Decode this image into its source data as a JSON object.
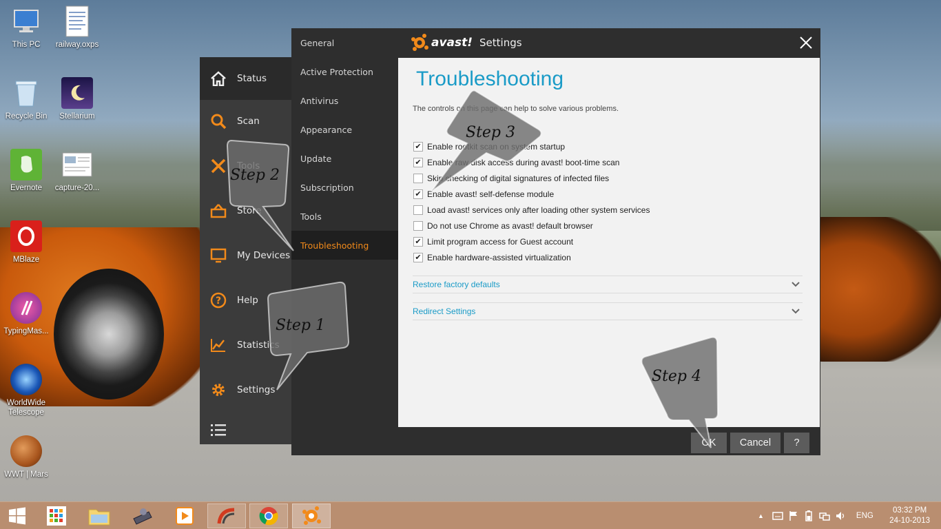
{
  "desktop": {
    "icons": [
      {
        "label": "This PC"
      },
      {
        "label": "railway.oxps"
      },
      {
        "label": "Recycle Bin"
      },
      {
        "label": "Stellarium"
      },
      {
        "label": "Evernote"
      },
      {
        "label": "capture-20..."
      },
      {
        "label": "MBlaze"
      },
      {
        "label": "TypingMas..."
      },
      {
        "label": "WorldWide Telescope"
      },
      {
        "label": "WWT | Mars"
      }
    ]
  },
  "avast_main": {
    "nav": [
      {
        "label": "Status",
        "icon": "home-icon"
      },
      {
        "label": "Scan",
        "icon": "search-icon"
      },
      {
        "label": "Tools",
        "icon": "wrench-icon"
      },
      {
        "label": "Store",
        "icon": "basket-icon"
      },
      {
        "label": "My Devices",
        "icon": "monitor-icon"
      },
      {
        "label": "Help",
        "icon": "help-icon"
      },
      {
        "label": "Statistics",
        "icon": "chart-icon"
      },
      {
        "label": "Settings",
        "icon": "gear-icon"
      }
    ]
  },
  "settings": {
    "logo_text": "avast!",
    "title": "Settings",
    "menu": [
      {
        "label": "General"
      },
      {
        "label": "Active Protection"
      },
      {
        "label": "Antivirus"
      },
      {
        "label": "Appearance"
      },
      {
        "label": "Update"
      },
      {
        "label": "Subscription"
      },
      {
        "label": "Tools"
      },
      {
        "label": "Troubleshooting"
      }
    ],
    "page_title": "Troubleshooting",
    "description": "The controls on this page can help to solve various problems.",
    "options": [
      {
        "label": "Enable rootkit scan on system startup",
        "checked": true
      },
      {
        "label": "Enable raw disk access during avast! boot-time scan",
        "checked": true
      },
      {
        "label": "Skip checking of digital signatures of infected files",
        "checked": false
      },
      {
        "label": "Enable avast! self-defense module",
        "checked": true
      },
      {
        "label": "Load avast! services only after loading other system services",
        "checked": false
      },
      {
        "label": "Do not use Chrome as avast! default browser",
        "checked": false
      },
      {
        "label": "Limit program access for Guest account",
        "checked": true
      },
      {
        "label": "Enable hardware-assisted virtualization",
        "checked": true
      }
    ],
    "sections": [
      {
        "label": "Restore factory defaults"
      },
      {
        "label": "Redirect Settings"
      }
    ],
    "buttons": {
      "ok": "OK",
      "cancel": "Cancel",
      "help": "?"
    }
  },
  "callouts": {
    "step1": "Step 1",
    "step2": "Step 2",
    "step3": "Step 3",
    "step4": "Step 4"
  },
  "taskbar": {
    "language": "ENG",
    "time": "03:32 PM",
    "date": "24-10-2013",
    "accent_color": "#b98e70"
  }
}
